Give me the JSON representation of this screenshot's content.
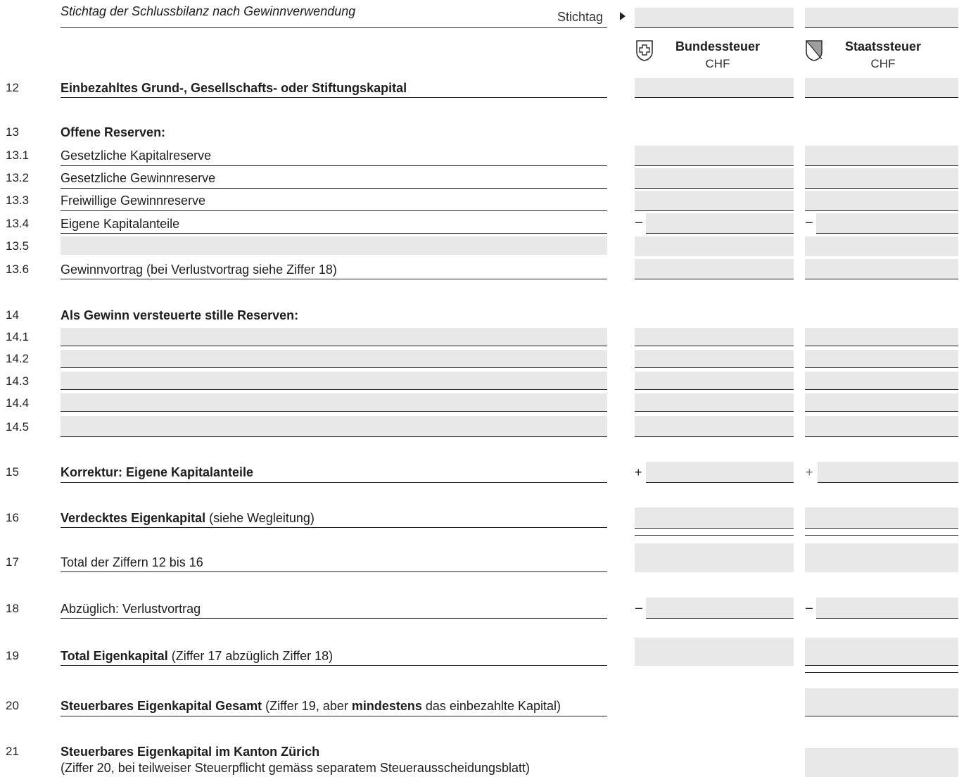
{
  "header": {
    "stichtag_title": "Stichtag der Schlussbilanz nach Gewinnverwendung",
    "stichtag_label": "Stichtag",
    "col_bund": {
      "title": "Bundessteuer",
      "unit": "CHF"
    },
    "col_staat": {
      "title": "Staatssteuer",
      "unit": "CHF"
    }
  },
  "rows": {
    "r12": {
      "num": "12",
      "label": "Einbezahltes Grund-, Gesellschafts- oder Stiftungskapital"
    },
    "r13": {
      "num": "13",
      "label": "Offene Reserven:"
    },
    "r13_1": {
      "num": "13.1",
      "label": "Gesetzliche Kapitalreserve"
    },
    "r13_2": {
      "num": "13.2",
      "label": "Gesetzliche Gewinnreserve"
    },
    "r13_3": {
      "num": "13.3",
      "label": "Freiwillige Gewinnreserve"
    },
    "r13_4": {
      "num": "13.4",
      "label": "Eigene Kapitalanteile",
      "sign": "–"
    },
    "r13_5": {
      "num": "13.5"
    },
    "r13_6": {
      "num": "13.6",
      "label": "Gewinnvortrag (bei Verlustvortrag siehe Ziffer 18)"
    },
    "r14": {
      "num": "14",
      "label": "Als Gewinn versteuerte stille Reserven:"
    },
    "r14_1": {
      "num": "14.1"
    },
    "r14_2": {
      "num": "14.2"
    },
    "r14_3": {
      "num": "14.3"
    },
    "r14_4": {
      "num": "14.4"
    },
    "r14_5": {
      "num": "14.5"
    },
    "r15": {
      "num": "15",
      "label": "Korrektur: Eigene Kapitalanteile",
      "sign": "+"
    },
    "r16": {
      "num": "16",
      "label_bold": "Verdecktes Eigenkapital",
      "label_rest": " (siehe Wegleitung)"
    },
    "r17": {
      "num": "17",
      "label": "Total der Ziffern 12 bis 16"
    },
    "r18": {
      "num": "18",
      "label": "Abzüglich: Verlustvortrag",
      "sign": "–"
    },
    "r19": {
      "num": "19",
      "label_bold": "Total Eigenkapital",
      "label_rest": " (Ziffer 17 abzüglich Ziffer 18)"
    },
    "r20": {
      "num": "20",
      "label_bold": "Steuerbares Eigenkapital Gesamt",
      "label_mid": " (Ziffer 19, aber ",
      "label_bold2": "mindestens",
      "label_rest": " das einbezahlte Kapital)"
    },
    "r21": {
      "num": "21",
      "label": "Steuerbares Eigenkapital im Kanton Zürich",
      "label_line2": "(Ziffer 20, bei teilweiser Steuerpflicht gemäss separatem Steuerausscheidungsblatt)"
    }
  }
}
